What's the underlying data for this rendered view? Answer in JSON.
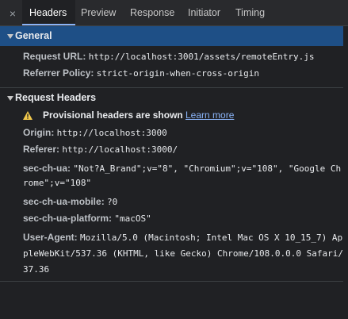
{
  "tabs": {
    "close_icon": "×",
    "items": [
      "Headers",
      "Preview",
      "Response",
      "Initiator",
      "Timing"
    ],
    "active": "Headers"
  },
  "general": {
    "title": "General",
    "request_url_key": "Request URL:",
    "request_url": "http://localhost:3001/assets/remoteEntry.js",
    "referrer_policy_key": "Referrer Policy:",
    "referrer_policy": "strict-origin-when-cross-origin"
  },
  "request_headers": {
    "title": "Request Headers",
    "warning": "Provisional headers are shown",
    "learn_more": "Learn more",
    "origin_key": "Origin:",
    "origin": "http://localhost:3000",
    "referer_key": "Referer:",
    "referer": "http://localhost:3000/",
    "sec_ch_ua_key": "sec-ch-ua:",
    "sec_ch_ua_line1": "\"Not?A_Brand\";v=\"8\", \"Chromium\";v=\"108\", \"Google Ch",
    "sec_ch_ua_line2": "rome\";v=\"108\"",
    "sec_ch_ua_mobile_key": "sec-ch-ua-mobile:",
    "sec_ch_ua_mobile": "?0",
    "sec_ch_ua_platform_key": "sec-ch-ua-platform:",
    "sec_ch_ua_platform": "\"macOS\"",
    "user_agent_key": "User-Agent:",
    "user_agent_line1": "Mozilla/5.0 (Macintosh; Intel Mac OS X 10_15_7) Ap",
    "user_agent_line2": "pleWebKit/537.36 (KHTML, like Gecko) Chrome/108.0.0.0 Safari/5",
    "user_agent_line3": "37.36"
  },
  "colors": {
    "background": "#202124",
    "tabbar": "#292a2d",
    "general_header": "#1e4f86",
    "link": "#8ab4f8",
    "warning": "#f2c94c"
  }
}
